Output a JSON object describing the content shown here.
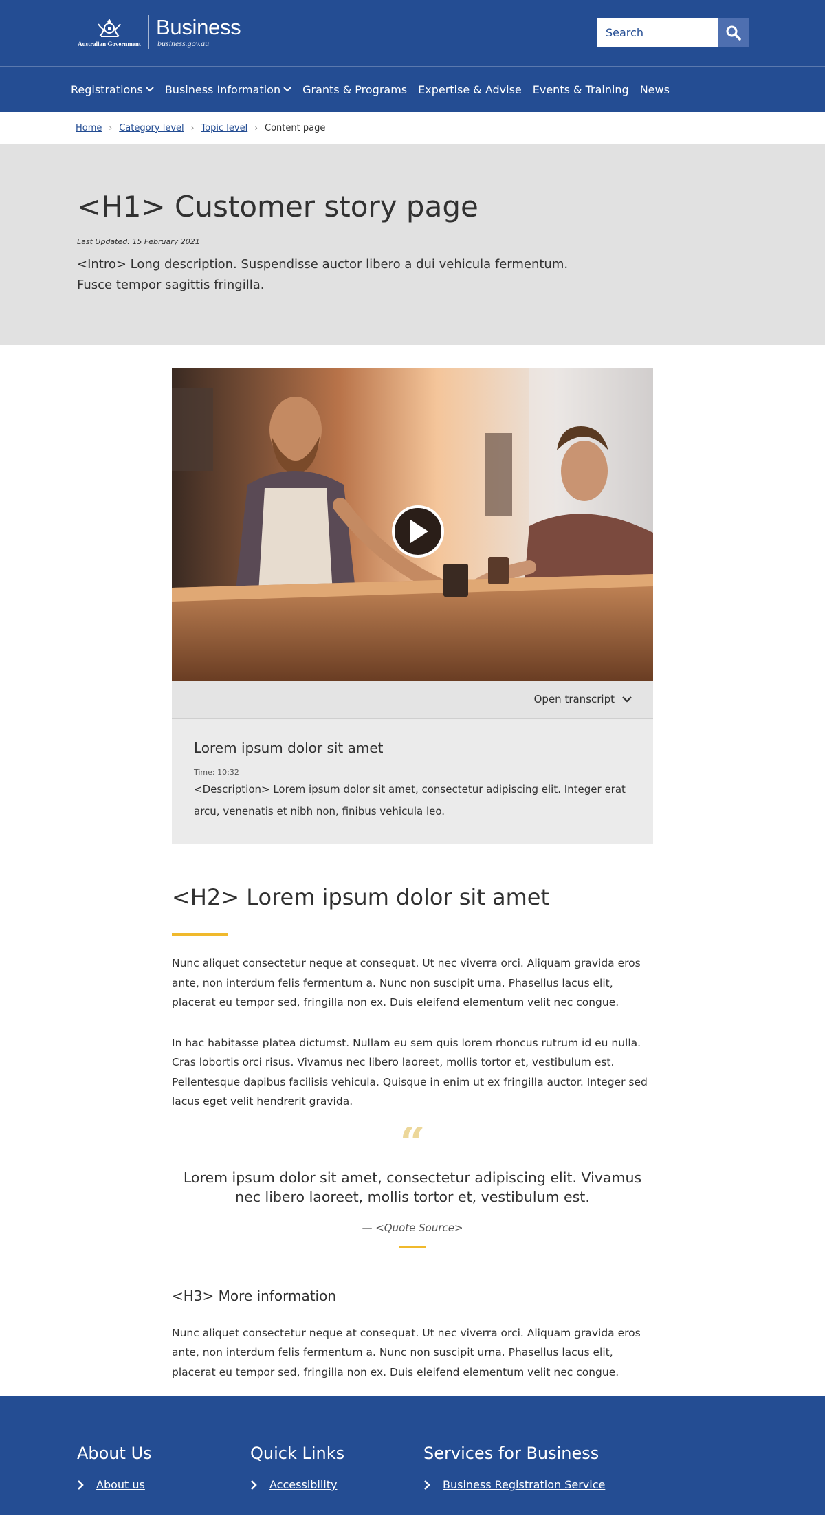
{
  "header": {
    "crest_text": "Australian Government",
    "brand_name": "Business",
    "brand_url": "business.gov.au",
    "search_placeholder": "Search"
  },
  "nav": {
    "items": [
      {
        "label": "Registrations",
        "has_dropdown": true
      },
      {
        "label": "Business Information",
        "has_dropdown": true
      },
      {
        "label": "Grants & Programs",
        "has_dropdown": false
      },
      {
        "label": "Expertise & Advise",
        "has_dropdown": false
      },
      {
        "label": "Events & Training",
        "has_dropdown": false
      },
      {
        "label": "News",
        "has_dropdown": false
      }
    ]
  },
  "breadcrumb": {
    "items": [
      "Home",
      "Category level",
      "Topic level"
    ],
    "current": "Content page"
  },
  "hero": {
    "title": "<H1> Customer story page",
    "last_updated": "Last Updated: 15 February 2021",
    "intro": "<Intro> Long description. Suspendisse auctor libero a dui vehicula fermentum. Fusce tempor sagittis fringilla."
  },
  "video": {
    "transcript_toggle": "Open transcript",
    "transcript_title": "Lorem ipsum dolor sit amet",
    "time": "Time: 10:32",
    "description": "<Description> Lorem ipsum dolor sit amet, consectetur adipiscing elit. Integer erat arcu, venenatis et nibh non, finibus vehicula leo."
  },
  "content": {
    "h2": "<H2> Lorem ipsum dolor sit amet",
    "p1": "Nunc aliquet consectetur neque at consequat. Ut nec viverra orci. Aliquam gravida eros ante, non interdum felis fermentum a. Nunc non suscipit urna. Phasellus lacus elit, placerat eu tempor sed, fringilla non ex. Duis eleifend elementum velit nec congue.",
    "p2": "In hac habitasse platea dictumst. Nullam eu sem quis lorem rhoncus rutrum id eu nulla. Cras lobortis orci risus. Vivamus nec libero laoreet, mollis tortor et, vestibulum est. Pellentesque dapibus facilisis vehicula. Quisque in enim ut ex fringilla auctor. Integer sed lacus eget velit hendrerit gravida.",
    "quote_mark": "“",
    "quote": "Lorem ipsum dolor sit amet, consectetur adipiscing elit. Vivamus nec libero laoreet, mollis tortor et, vestibulum est.",
    "quote_source": "— <Quote Source>",
    "h3": "<H3> More information",
    "p3": "Nunc aliquet consectetur neque at consequat. Ut nec viverra orci. Aliquam gravida eros ante, non interdum felis fermentum a. Nunc non suscipit urna. Phasellus lacus elit, placerat eu tempor sed, fringilla non ex. Duis eleifend elementum velit nec congue."
  },
  "footer": {
    "columns": [
      {
        "heading": "About Us",
        "link": "About us"
      },
      {
        "heading": "Quick Links",
        "link": "Accessibility"
      },
      {
        "heading": "Services for Business",
        "link": "Business Registration Service"
      }
    ]
  },
  "colors": {
    "brand_blue": "#244d93",
    "accent_yellow": "#f0b92c",
    "hero_grey": "#e1e1e1"
  }
}
